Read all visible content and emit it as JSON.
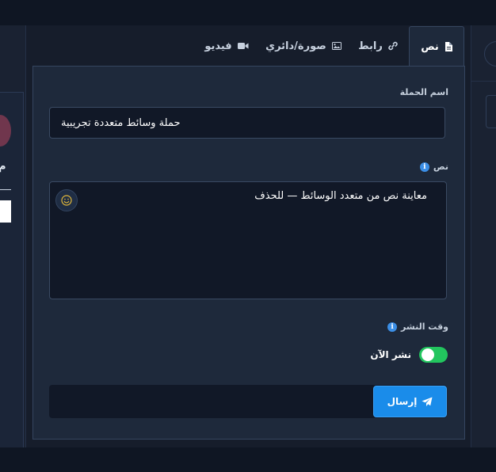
{
  "tabs": [
    {
      "id": "text",
      "label": "نص",
      "icon": "document-icon",
      "active": true
    },
    {
      "id": "link",
      "label": "رابط",
      "icon": "link-icon",
      "active": false
    },
    {
      "id": "image",
      "label": "صورة/دائري",
      "icon": "image-icon",
      "active": false
    },
    {
      "id": "video",
      "label": "فيديو",
      "icon": "video-camera-icon",
      "active": false
    }
  ],
  "form": {
    "campaign_label": "اسم الحملة",
    "campaign_value": "حملة وسائط متعددة تجريبية",
    "text_label": "نص",
    "text_value": "معاينة نص من متعدد الوسائط — للحذف",
    "schedule_label": "وقت النشر",
    "publish_now_label": "نشر الآن",
    "publish_now_on": true,
    "send_label": "إرسال"
  },
  "left_panel": {
    "glyph": "م"
  },
  "colors": {
    "accent": "#1a8cea",
    "toggle_on": "#22c55e",
    "info": "#3b8ee6"
  }
}
